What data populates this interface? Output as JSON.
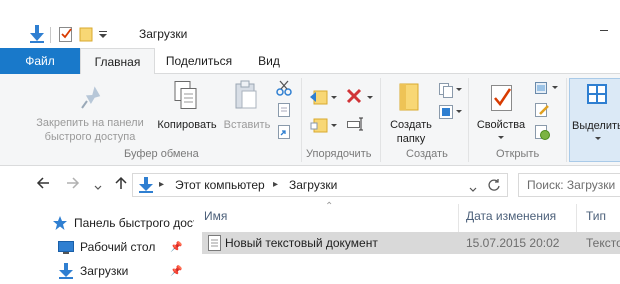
{
  "window": {
    "title": "Загрузки"
  },
  "tabs": {
    "file": "Файл",
    "home": "Главная",
    "share": "Поделиться",
    "view": "Вид"
  },
  "ribbon": {
    "clipboard": {
      "pin_line1": "Закрепить на панели",
      "pin_line2": "быстрого доступа",
      "copy": "Копировать",
      "paste": "Вставить",
      "group": "Буфер обмена"
    },
    "organize": {
      "group": "Упорядочить"
    },
    "new": {
      "new_folder_line1": "Создать",
      "new_folder_line2": "папку",
      "group": "Создать"
    },
    "open": {
      "properties": "Свойства",
      "group": "Открыть"
    },
    "select": {
      "label": "Выделить"
    }
  },
  "address": {
    "segments": [
      "Этот компьютер",
      "Загрузки"
    ],
    "search_placeholder": "Поиск: Загрузки"
  },
  "nav": {
    "items": [
      {
        "label": "Панель быстрого доступа",
        "icon": "star-icon"
      },
      {
        "label": "Рабочий стол",
        "icon": "desktop-icon"
      },
      {
        "label": "Загрузки",
        "icon": "download-icon"
      }
    ]
  },
  "files": {
    "columns": {
      "name": "Имя",
      "date": "Дата изменения",
      "type": "Тип"
    },
    "rows": [
      {
        "name": "Новый текстовый документ",
        "date": "15.07.2015 20:02",
        "type": "Тексто"
      }
    ]
  },
  "colors": {
    "accent": "#1979ca",
    "selection": "#d9d9d9",
    "ribbon_bg": "#f5f6f7"
  }
}
